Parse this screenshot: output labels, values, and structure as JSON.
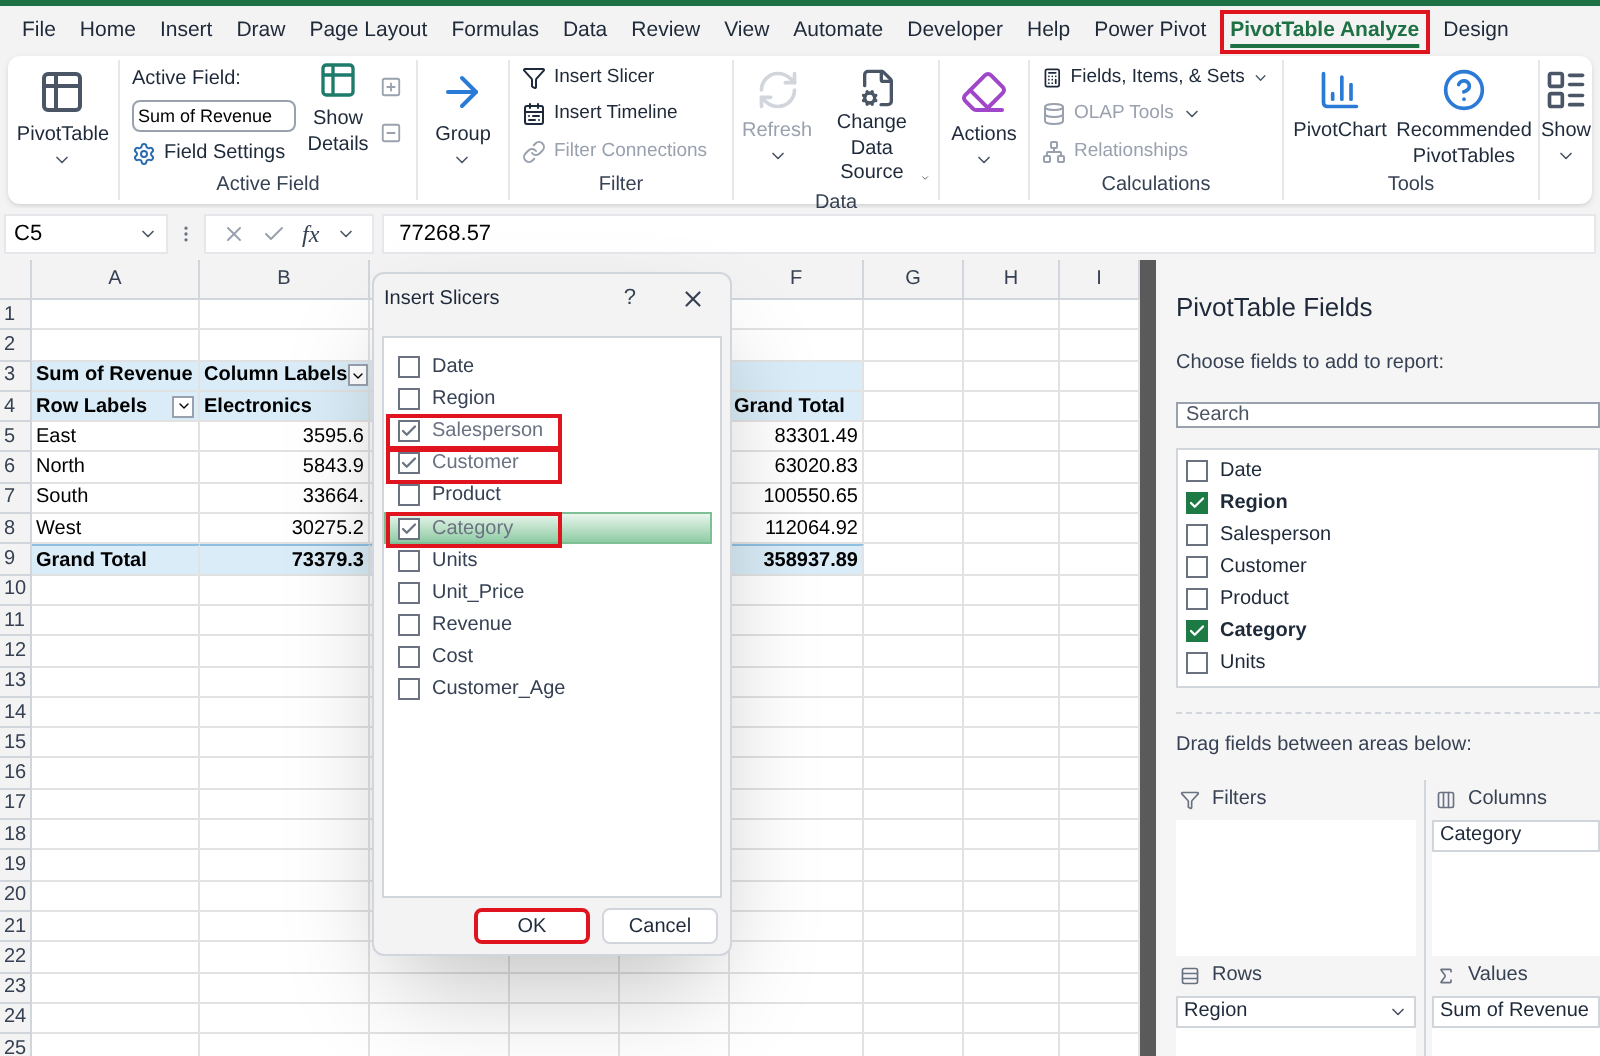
{
  "menu_tabs": [
    {
      "label": "File",
      "selected": false,
      "highlighted": false
    },
    {
      "label": "Home",
      "selected": false,
      "highlighted": false
    },
    {
      "label": "Insert",
      "selected": false,
      "highlighted": false
    },
    {
      "label": "Draw",
      "selected": false,
      "highlighted": false
    },
    {
      "label": "Page Layout",
      "selected": false,
      "highlighted": false
    },
    {
      "label": "Formulas",
      "selected": false,
      "highlighted": false
    },
    {
      "label": "Data",
      "selected": false,
      "highlighted": false
    },
    {
      "label": "Review",
      "selected": false,
      "highlighted": false
    },
    {
      "label": "View",
      "selected": false,
      "highlighted": false
    },
    {
      "label": "Automate",
      "selected": false,
      "highlighted": false
    },
    {
      "label": "Developer",
      "selected": false,
      "highlighted": false
    },
    {
      "label": "Help",
      "selected": false,
      "highlighted": false
    },
    {
      "label": "Power Pivot",
      "selected": false,
      "highlighted": false
    },
    {
      "label": "PivotTable Analyze",
      "selected": true,
      "highlighted": true
    },
    {
      "label": "Design",
      "selected": false,
      "highlighted": false
    }
  ],
  "ribbon": {
    "pivottable": {
      "label": "PivotTable"
    },
    "active_field": {
      "caption": "Active Field:",
      "value": "Sum of Revenue",
      "field_settings": "Field Settings",
      "show_details": "Show Details",
      "group_label": "Active Field"
    },
    "group": {
      "label": "Group"
    },
    "filter": {
      "items": [
        {
          "label": "Insert Slicer",
          "disabled": false
        },
        {
          "label": "Insert Timeline",
          "disabled": false
        },
        {
          "label": "Filter Connections",
          "disabled": true
        }
      ],
      "group_label": "Filter"
    },
    "data": {
      "refresh": {
        "label": "Refresh",
        "disabled": true
      },
      "change_source": {
        "label": "Change Data Source",
        "disabled": false
      },
      "group_label": "Data"
    },
    "actions": {
      "label": "Actions"
    },
    "calculations": {
      "items": [
        {
          "label": "Fields, Items, & Sets",
          "disabled": false
        },
        {
          "label": "OLAP Tools",
          "disabled": true
        },
        {
          "label": "Relationships",
          "disabled": true
        }
      ],
      "group_label": "Calculations"
    },
    "tools": {
      "items": [
        {
          "label": "PivotChart"
        },
        {
          "label": "Recommended PivotTables"
        }
      ],
      "group_label": "Tools"
    },
    "show": {
      "label": "Show"
    }
  },
  "formula_bar": {
    "name_box": "C5",
    "fx": "fx",
    "formula": "77268.57"
  },
  "sheet": {
    "columns": [
      "A",
      "B",
      "F",
      "G",
      "H",
      "I"
    ],
    "row_numbers": [
      "1",
      "2",
      "3",
      "4",
      "5",
      "6",
      "7",
      "8",
      "9",
      "10",
      "11",
      "12",
      "13",
      "14",
      "15",
      "16",
      "17",
      "18",
      "19",
      "20",
      "21",
      "22",
      "23",
      "24",
      "25"
    ],
    "pivot": {
      "header_1": {
        "a": "Sum of Revenue",
        "b": "Column Labels"
      },
      "header_2": {
        "a": "Row Labels",
        "b": "Electronics",
        "f": "Grand Total"
      },
      "rows": [
        {
          "a": "East",
          "b": "3595.6",
          "f": "83301.49"
        },
        {
          "a": "North",
          "b": "5843.9",
          "f": "63020.83"
        },
        {
          "a": "South",
          "b": "33664.",
          "f": "100550.65"
        },
        {
          "a": "West",
          "b": "30275.2",
          "f": "112064.92"
        }
      ],
      "total": {
        "a": "Grand Total",
        "b": "73379.3",
        "f": "358937.89"
      }
    }
  },
  "dialog": {
    "title": "Insert Slicers",
    "help": "?",
    "fields": [
      {
        "label": "Date",
        "checked": false,
        "selected": false,
        "highlighted": false
      },
      {
        "label": "Region",
        "checked": false,
        "selected": false,
        "highlighted": false
      },
      {
        "label": "Salesperson",
        "checked": true,
        "selected": false,
        "highlighted": true
      },
      {
        "label": "Customer",
        "checked": true,
        "selected": false,
        "highlighted": true
      },
      {
        "label": "Product",
        "checked": false,
        "selected": false,
        "highlighted": false
      },
      {
        "label": "Category",
        "checked": true,
        "selected": true,
        "highlighted": true
      },
      {
        "label": "Units",
        "checked": false,
        "selected": false,
        "highlighted": false
      },
      {
        "label": "Unit_Price",
        "checked": false,
        "selected": false,
        "highlighted": false
      },
      {
        "label": "Revenue",
        "checked": false,
        "selected": false,
        "highlighted": false
      },
      {
        "label": "Cost",
        "checked": false,
        "selected": false,
        "highlighted": false
      },
      {
        "label": "Customer_Age",
        "checked": false,
        "selected": false,
        "highlighted": false
      }
    ],
    "ok": {
      "label": "OK",
      "highlighted": true
    },
    "cancel": {
      "label": "Cancel",
      "highlighted": false
    }
  },
  "pane": {
    "title": "PivotTable Fields",
    "subtitle": "Choose fields to add to report:",
    "search_placeholder": "Search",
    "fields": [
      {
        "label": "Date",
        "checked": false
      },
      {
        "label": "Region",
        "checked": true
      },
      {
        "label": "Salesperson",
        "checked": false
      },
      {
        "label": "Customer",
        "checked": false
      },
      {
        "label": "Product",
        "checked": false
      },
      {
        "label": "Category",
        "checked": true
      },
      {
        "label": "Units",
        "checked": false
      }
    ],
    "drag_hint": "Drag fields between areas below:",
    "filters": {
      "label": "Filters"
    },
    "columns": {
      "label": "Columns",
      "items": [
        "Category"
      ]
    },
    "rows": {
      "label": "Rows",
      "items": [
        "Region"
      ]
    },
    "values": {
      "label": "Values",
      "items": [
        "Sum of Revenue"
      ]
    }
  }
}
